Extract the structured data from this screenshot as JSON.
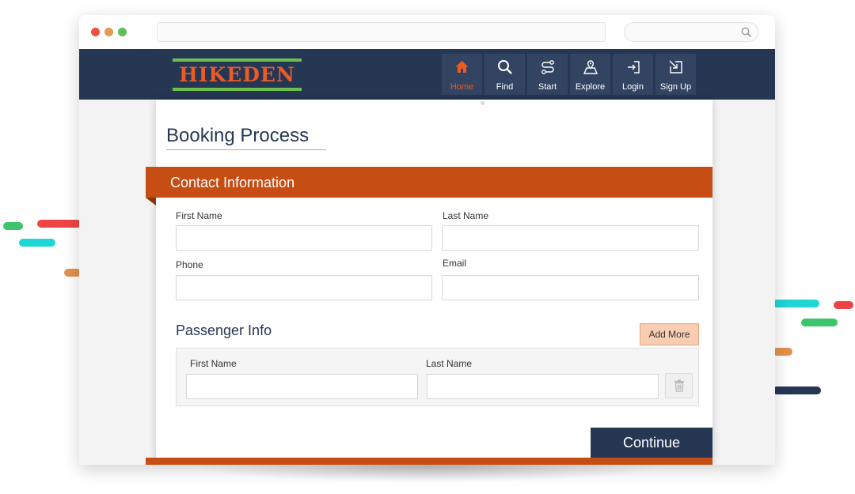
{
  "colors": {
    "header_bg": "#263754",
    "accent_orange": "#c64d14",
    "logo_text": "#ee5a24",
    "logo_bar": "#6cc04a",
    "continue_bg": "#263754",
    "add_more_bg": "#f8cdb2"
  },
  "browser": {
    "window_controls": [
      "close",
      "minimize",
      "maximize"
    ],
    "url_value": "",
    "search_icon": "search-icon"
  },
  "header": {
    "logo_text": "HIKEDEN",
    "nav": [
      {
        "label": "Home",
        "icon": "home-icon",
        "active": true
      },
      {
        "label": "Find",
        "icon": "search-icon",
        "active": false
      },
      {
        "label": "Start",
        "icon": "route-icon",
        "active": false
      },
      {
        "label": "Explore",
        "icon": "map-icon",
        "active": false
      },
      {
        "label": "Login",
        "icon": "login-icon",
        "active": false
      },
      {
        "label": "Sign Up",
        "icon": "signup-icon",
        "active": false
      }
    ]
  },
  "page": {
    "title": "Booking Process",
    "contact_section": {
      "title": "Contact Information",
      "first_name_label": "First Name",
      "first_name_value": "",
      "last_name_label": "Last Name",
      "last_name_value": "",
      "phone_label": "Phone",
      "phone_value": "",
      "email_label": "Email",
      "email_value": ""
    },
    "passenger_section": {
      "title": "Passenger Info",
      "add_more_label": "Add More",
      "first_name_label": "First Name",
      "first_name_value": "",
      "last_name_label": "Last Name",
      "last_name_value": "",
      "delete_icon": "trash-icon"
    },
    "continue_label": "Continue"
  }
}
